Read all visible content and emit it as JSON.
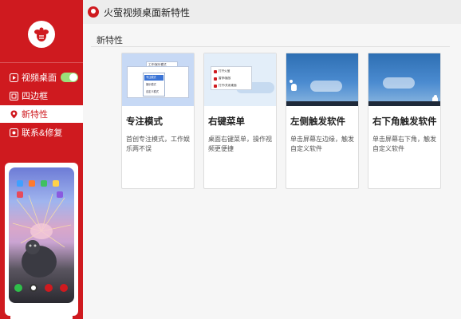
{
  "window": {
    "title": "火萤视频桌面新特性"
  },
  "sidebar": {
    "items": [
      {
        "label": "视频桌面",
        "icon": "play-icon",
        "toggle_on": true
      },
      {
        "label": "四边框",
        "icon": "frame-icon"
      },
      {
        "label": "新特性",
        "icon": "location-icon",
        "active": true
      },
      {
        "label": "联系&修复",
        "icon": "contact-icon"
      }
    ]
  },
  "main": {
    "section_title": "新特性",
    "cards": [
      {
        "title": "专注模式",
        "desc": "首创专注模式，工作娱乐两不误",
        "thumb_menu": [
          "专注模式",
          "娱乐模式",
          "自定义模式"
        ],
        "thumb_top": "工作/娱乐模式"
      },
      {
        "title": "右键菜单",
        "desc": "桌面右键菜单，操作视频更便捷",
        "thumb_menu": [
          "打开火萤",
          "暂停/播放",
          "打开/关闭桌面"
        ]
      },
      {
        "title": "左侧触发软件",
        "desc": "单击屏幕左边缘，触发自定义软件"
      },
      {
        "title": "右下角触发软件",
        "desc": "单击屏幕右下角，触发自定义软件"
      }
    ]
  },
  "colors": {
    "brand": "#cf1a1f",
    "toggle_on": "#9be07a"
  }
}
